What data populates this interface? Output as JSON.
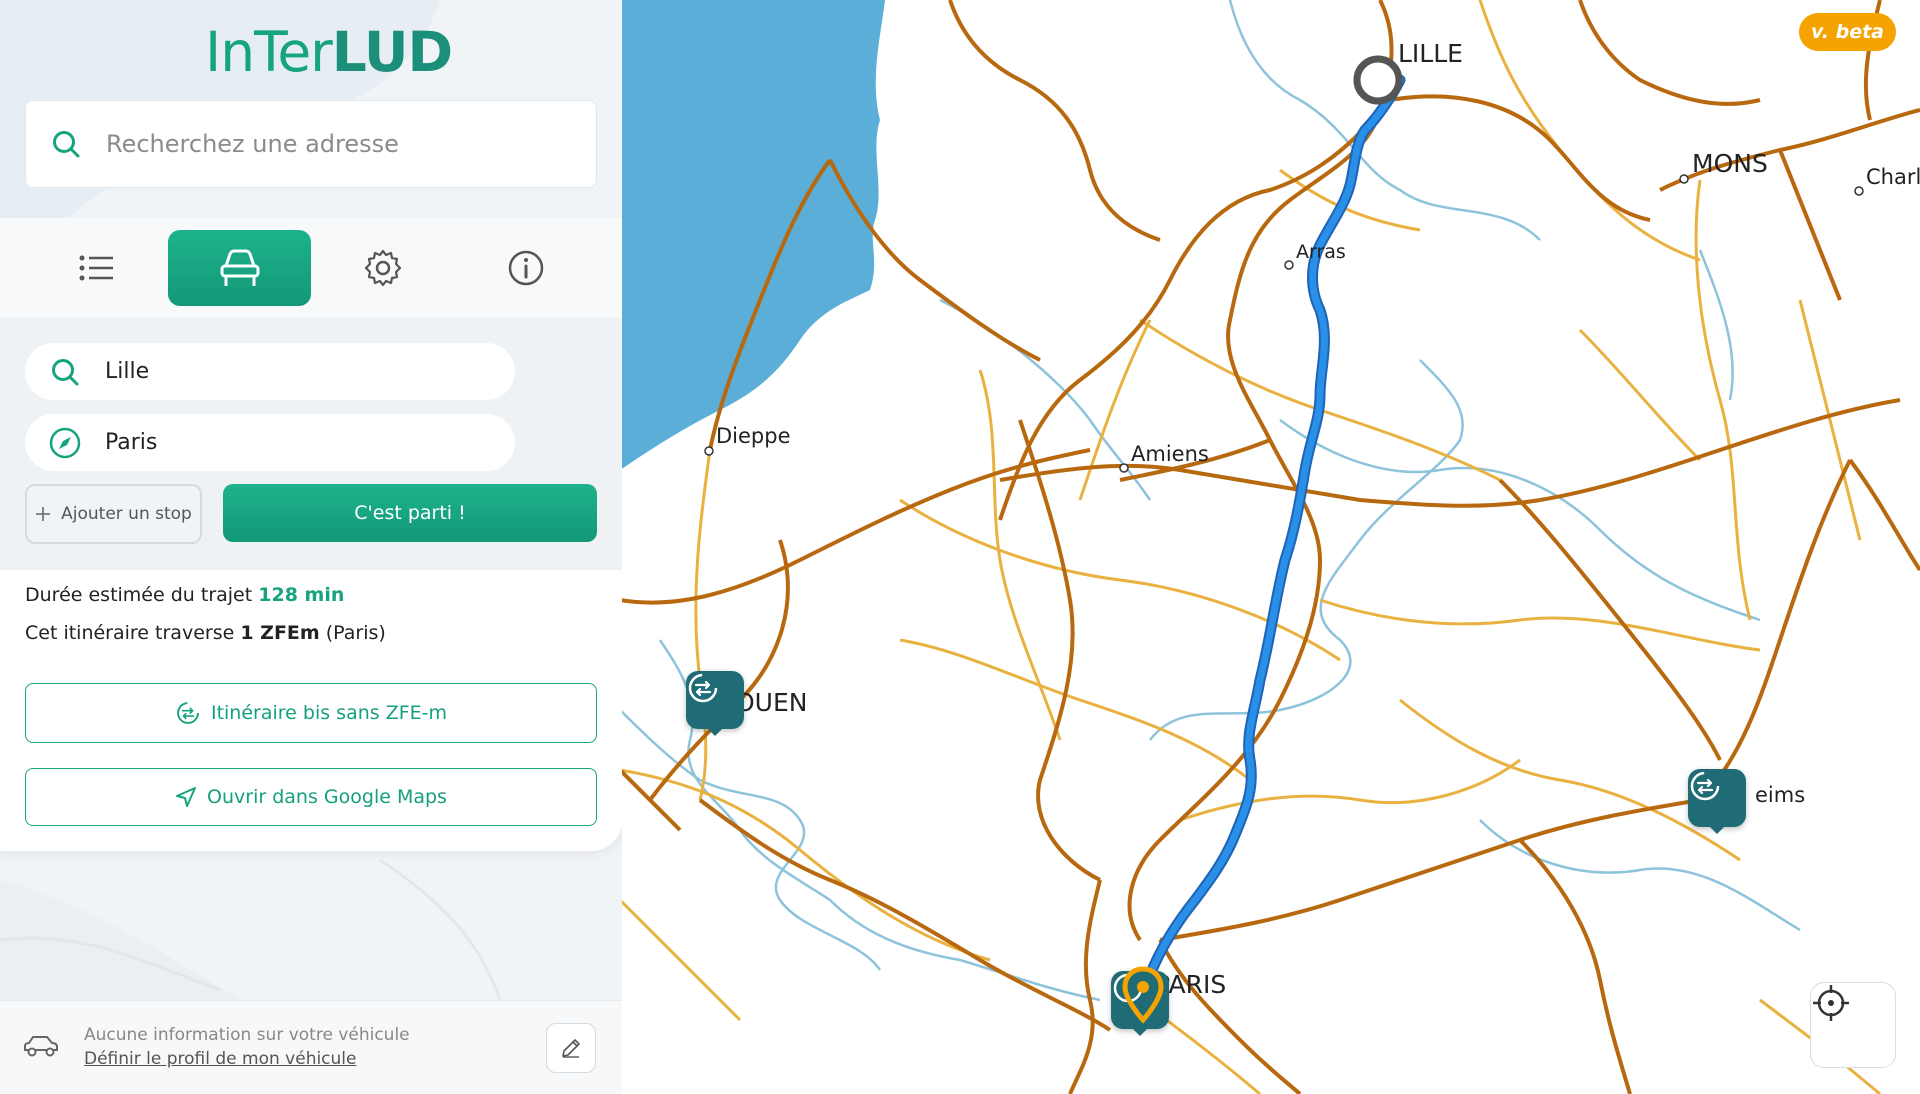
{
  "app": {
    "name": "InTerLUD",
    "version_badge": "v. beta"
  },
  "search": {
    "placeholder": "Recherchez une adresse",
    "icon": "search-icon"
  },
  "tabs": [
    {
      "name": "list",
      "icon": "list-icon",
      "active": false
    },
    {
      "name": "itinerary",
      "icon": "car-icon",
      "active": true
    },
    {
      "name": "settings",
      "icon": "gear-icon",
      "active": false
    },
    {
      "name": "info",
      "icon": "info-icon",
      "active": false
    }
  ],
  "route": {
    "origin": "Lille",
    "destination": "Paris",
    "add_stop_label": "Ajouter un stop",
    "go_label": "C'est parti !",
    "duration_prefix": "Durée estimée du trajet",
    "duration_value": "128 min",
    "zfe_prefix": "Cet itinéraire traverse",
    "zfe_count": "1 ZFEm",
    "zfe_suffix": "(Paris)",
    "alt_route_label": "Itinéraire bis sans ZFE-m",
    "google_maps_label": "Ouvrir dans Google Maps"
  },
  "vehicle": {
    "status": "Aucune information sur votre véhicule",
    "define_link": "Définir le profil de mon véhicule"
  },
  "map": {
    "cities": [
      "LILLE",
      "MONS",
      "Charl",
      "Arras",
      "Dieppe",
      "Amiens",
      "OUEN",
      "PARIS",
      "eims"
    ],
    "colors": {
      "sea": "#5aaed8",
      "route": "#2a8fe6",
      "major_road": "#b8690f",
      "minor_road": "#e9b13f",
      "river": "#8ec3dc",
      "brand": "#16a37f",
      "zfe_marker": "#1f6b76"
    }
  }
}
